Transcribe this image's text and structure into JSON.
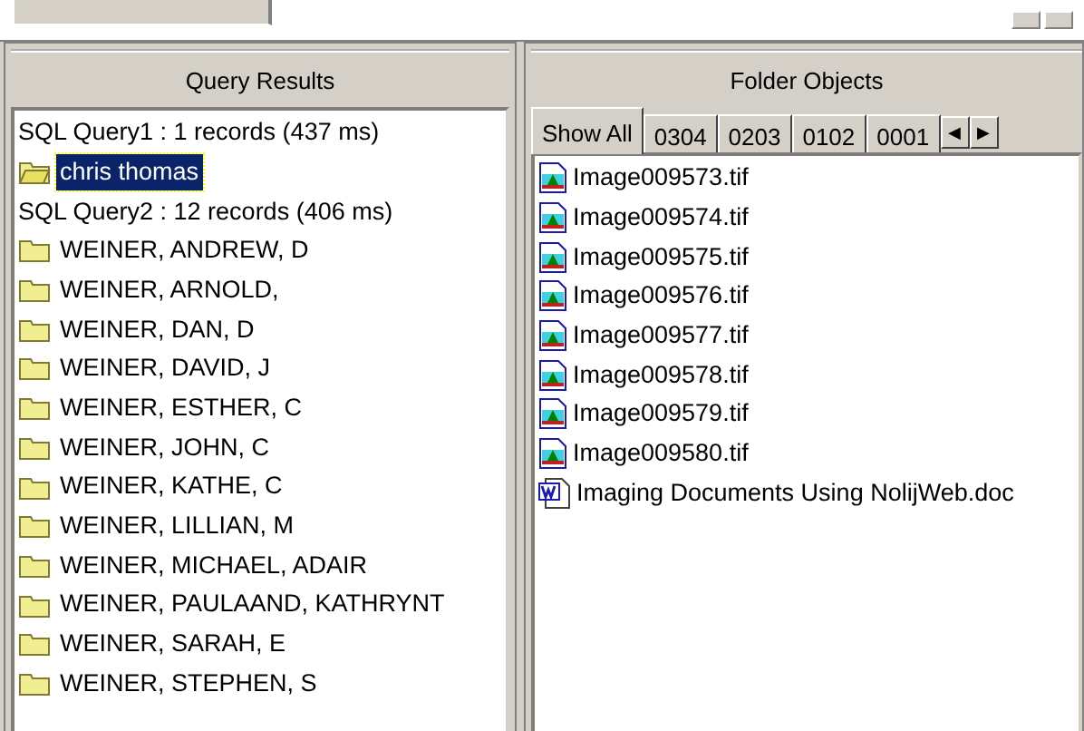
{
  "query_panel": {
    "title": "Query Results",
    "items": [
      {
        "kind": "header",
        "text": "SQL Query1 : 1 records (437 ms)"
      },
      {
        "kind": "folder",
        "text": "chris thomas",
        "selected": true
      },
      {
        "kind": "header",
        "text": "SQL Query2 : 12 records (406 ms)"
      },
      {
        "kind": "folder",
        "text": "WEINER, ANDREW, D",
        "selected": false
      },
      {
        "kind": "folder",
        "text": "WEINER, ARNOLD,",
        "selected": false
      },
      {
        "kind": "folder",
        "text": "WEINER, DAN, D",
        "selected": false
      },
      {
        "kind": "folder",
        "text": "WEINER, DAVID, J",
        "selected": false
      },
      {
        "kind": "folder",
        "text": "WEINER, ESTHER, C",
        "selected": false
      },
      {
        "kind": "folder",
        "text": "WEINER, JOHN, C",
        "selected": false
      },
      {
        "kind": "folder",
        "text": "WEINER, KATHE, C",
        "selected": false
      },
      {
        "kind": "folder",
        "text": "WEINER, LILLIAN, M",
        "selected": false
      },
      {
        "kind": "folder",
        "text": "WEINER, MICHAEL, ADAIR",
        "selected": false
      },
      {
        "kind": "folder",
        "text": "WEINER, PAULAAND, KATHRYNT",
        "selected": false
      },
      {
        "kind": "folder",
        "text": "WEINER, SARAH, E",
        "selected": false
      },
      {
        "kind": "folder",
        "text": "WEINER, STEPHEN, S",
        "selected": false
      }
    ]
  },
  "folder_panel": {
    "title": "Folder Objects",
    "tabs": [
      {
        "label": "Show All",
        "selected": true
      },
      {
        "label": "0304",
        "selected": false
      },
      {
        "label": "0203",
        "selected": false
      },
      {
        "label": "0102",
        "selected": false
      },
      {
        "label": "0001",
        "selected": false
      }
    ],
    "scroll_buttons": [
      "◀",
      "▶"
    ],
    "files": [
      {
        "kind": "image",
        "name": "Image009573.tif"
      },
      {
        "kind": "image",
        "name": "Image009574.tif"
      },
      {
        "kind": "image",
        "name": "Image009575.tif"
      },
      {
        "kind": "image",
        "name": "Image009576.tif"
      },
      {
        "kind": "image",
        "name": "Image009577.tif"
      },
      {
        "kind": "image",
        "name": "Image009578.tif"
      },
      {
        "kind": "image",
        "name": "Image009579.tif"
      },
      {
        "kind": "image",
        "name": "Image009580.tif"
      },
      {
        "kind": "document",
        "name": "Imaging Documents Using NolijWeb.doc"
      }
    ]
  }
}
